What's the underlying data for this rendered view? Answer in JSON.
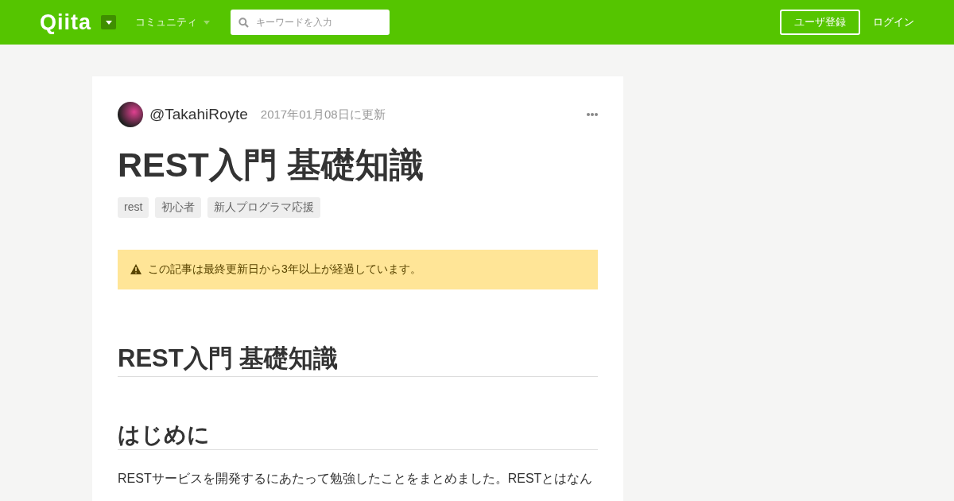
{
  "header": {
    "logo": "Qiita",
    "community_menu": "コミュニティ",
    "search": {
      "placeholder": "キーワードを入力"
    },
    "signup_button": "ユーザ登録",
    "login_link": "ログイン"
  },
  "article": {
    "author": "@TakahiRoyte",
    "updated": "2017年01月08日に更新",
    "title": "REST入門 基礎知識",
    "tags": [
      "rest",
      "初心者",
      "新人プログラマ応援"
    ],
    "alert": "この記事は最終更新日から3年以上が経過しています。",
    "body": [
      {
        "kind": "h1",
        "text": "REST入門 基礎知識"
      },
      {
        "kind": "h2",
        "text": "はじめに"
      },
      {
        "kind": "p",
        "text": "RESTサービスを開発するにあたって勉強したことをまとめました。RESTとはなん"
      }
    ]
  }
}
